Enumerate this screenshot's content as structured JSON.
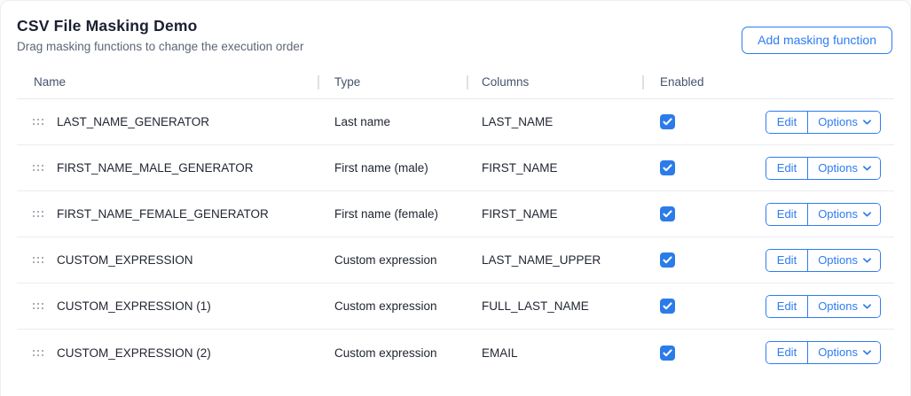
{
  "page": {
    "title": "CSV File Masking Demo",
    "subtitle": "Drag masking functions to change the execution order",
    "add_button_label": "Add masking function"
  },
  "table": {
    "headers": [
      "Name",
      "Type",
      "Columns",
      "Enabled"
    ],
    "row_actions": {
      "edit_label": "Edit",
      "options_label": "Options"
    },
    "rows": [
      {
        "name": "LAST_NAME_GENERATOR",
        "type": "Last name",
        "columns": "LAST_NAME",
        "enabled": true
      },
      {
        "name": "FIRST_NAME_MALE_GENERATOR",
        "type": "First name (male)",
        "columns": "FIRST_NAME",
        "enabled": true
      },
      {
        "name": "FIRST_NAME_FEMALE_GENERATOR",
        "type": "First name (female)",
        "columns": "FIRST_NAME",
        "enabled": true
      },
      {
        "name": "CUSTOM_EXPRESSION",
        "type": "Custom expression",
        "columns": "LAST_NAME_UPPER",
        "enabled": true
      },
      {
        "name": "CUSTOM_EXPRESSION (1)",
        "type": "Custom expression",
        "columns": "FULL_LAST_NAME",
        "enabled": true
      },
      {
        "name": "CUSTOM_EXPRESSION (2)",
        "type": "Custom expression",
        "columns": "EMAIL",
        "enabled": true
      }
    ]
  },
  "icons": {
    "drag_handle": "drag-handle-icon",
    "checkmark": "checkmark-icon",
    "chevron_down": "chevron-down-icon"
  },
  "colors": {
    "accent": "#2e7cf0",
    "checkbox": "#2b7ce9"
  }
}
